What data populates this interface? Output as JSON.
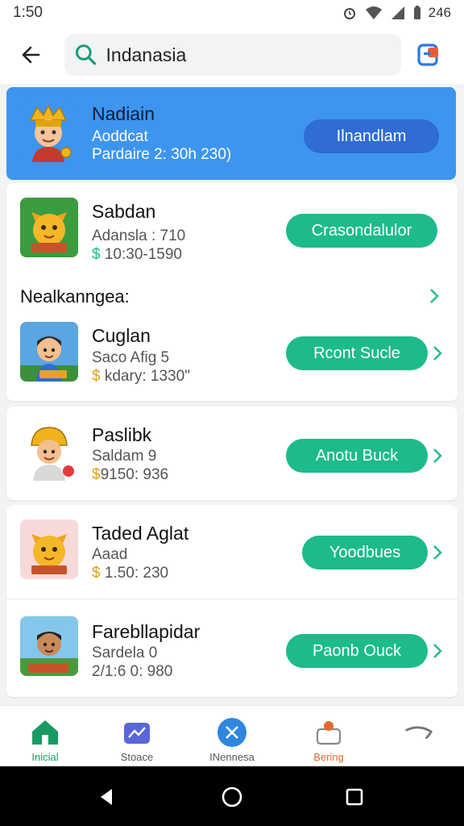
{
  "status_bar": {
    "time": "1:50",
    "right_text": "246"
  },
  "header": {
    "search_value": "Indanasia"
  },
  "featured": {
    "title": "Nadiain",
    "line1": "Aoddcat",
    "line2": "Pardaire 2: 30h  230)",
    "button": "Ilnandlam"
  },
  "section": {
    "title": "Nealkanngea:"
  },
  "games": [
    {
      "title": "Sabdan",
      "line1": "Adansla : 710",
      "line2": "10:30-1590",
      "currency": "$",
      "button": "Crasondalulor"
    },
    {
      "title": "Cuglan",
      "line1": "Saco Afig 5",
      "line2": "kdary: 1330\"",
      "currency": "$",
      "button": "Rcont Sucle"
    },
    {
      "title": "Paslibk",
      "line1": "Saldam 9",
      "line2": "9150: 936",
      "currency": "$",
      "button": "Anotu Buck"
    },
    {
      "title": "Taded Aglat",
      "line1": "Aaad",
      "line2": "1.50: 230",
      "currency": "$",
      "button": "Yoodbues"
    },
    {
      "title": "Farebllapidar",
      "line1": "Sardela 0",
      "line2": "2/1:6 0: 980",
      "currency": "",
      "button": "Paonb Ouck"
    }
  ],
  "bottom_nav": [
    {
      "label": "Inicial",
      "color": "#1a9a63"
    },
    {
      "label": "Stoace",
      "color": "#5a66d8"
    },
    {
      "label": "INennesa",
      "color": "#2e86de"
    },
    {
      "label": "Bering",
      "color": "#e06a2b"
    },
    {
      "label": "",
      "color": "#777777"
    }
  ],
  "colors": {
    "accent_green": "#1dba8c",
    "featured_bg": "#3d95f0",
    "featured_button": "#2f6cd3"
  }
}
